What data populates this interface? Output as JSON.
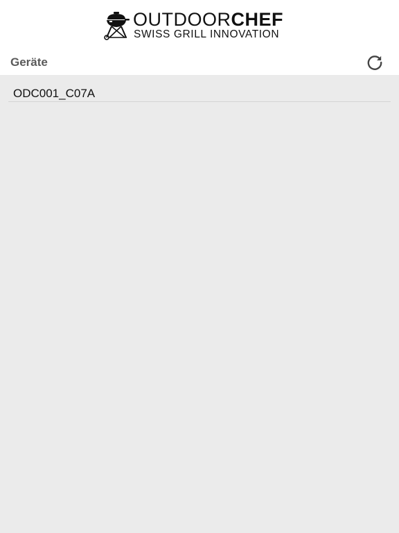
{
  "header": {
    "brand_light": "OUTDOOR",
    "brand_bold": "CHEF",
    "tagline": "SWISS GRILL INNOVATION",
    "logo_icon": "grill-icon"
  },
  "section": {
    "title": "Geräte",
    "refresh_icon": "refresh-icon"
  },
  "devices": [
    {
      "label": "ODC001_C07A"
    }
  ],
  "colors": {
    "background": "#ebebeb",
    "header_background": "#ffffff",
    "section_title": "#5a5a5a",
    "icon": "#444444",
    "text": "#111111",
    "divider": "#d4d4d4"
  }
}
